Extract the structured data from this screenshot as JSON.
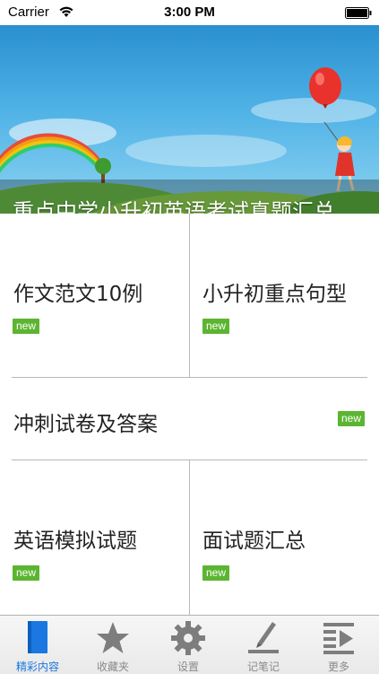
{
  "status_bar": {
    "carrier": "Carrier",
    "time": "3:00 PM"
  },
  "banner": {
    "title": "重点中学小升初英语考试真题汇总"
  },
  "grid": {
    "items": [
      {
        "label": "作文范文10例",
        "badge": "new"
      },
      {
        "label": "小升初重点句型",
        "badge": "new"
      },
      {
        "label": "冲刺试卷及答案",
        "badge": "new"
      },
      {
        "label": "英语模拟试题",
        "badge": "new"
      },
      {
        "label": "面试题汇总",
        "badge": "new"
      }
    ]
  },
  "tab_bar": {
    "tabs": [
      {
        "label": "精彩内容",
        "icon": "book-icon",
        "active": true
      },
      {
        "label": "收藏夹",
        "icon": "star-icon",
        "active": false
      },
      {
        "label": "设置",
        "icon": "gear-icon",
        "active": false
      },
      {
        "label": "记笔记",
        "icon": "pen-icon",
        "active": false
      },
      {
        "label": "更多",
        "icon": "more-icon",
        "active": false
      }
    ]
  },
  "colors": {
    "accent": "#1a78e0",
    "badge": "#5cb531",
    "divider": "#b8b8b8",
    "tab_inactive": "#8a8a8a"
  }
}
